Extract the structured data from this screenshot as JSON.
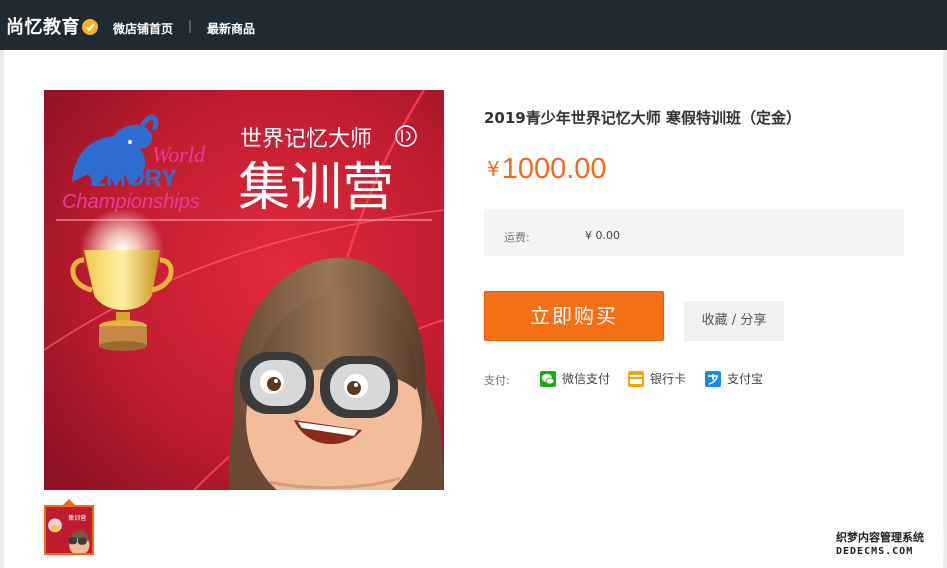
{
  "header": {
    "shop_name": "尚忆教育",
    "nav_home": "微店铺首页",
    "nav_separator": "|",
    "nav_new": "最新商品",
    "verified_icon": "check-badge-icon",
    "bg_color": "#1f2a33"
  },
  "product": {
    "title": "2019青少年世界记忆大师 寒假特训班（定金）",
    "currency": "¥",
    "price": "1000.00",
    "shipping_label": "运费:",
    "shipping_value": "¥ 0.00",
    "buy_label": "立即购买",
    "fav_label": "收藏 / 分享",
    "accent_color": "#f46f16"
  },
  "image": {
    "logo_world": "World",
    "logo_memory": "EMORY",
    "logo_championships": "Championships",
    "heading": "世界记忆大师",
    "big_text": "集训营"
  },
  "payment": {
    "label": "支付:",
    "methods": [
      {
        "label": "微信支付",
        "icon": "wechat-pay-icon"
      },
      {
        "label": "银行卡",
        "icon": "bank-card-icon"
      },
      {
        "label": "支付宝",
        "icon": "alipay-icon"
      }
    ]
  },
  "watermark": {
    "line1": "织梦内容管理系统",
    "line2": "DEDECMS.COM"
  }
}
